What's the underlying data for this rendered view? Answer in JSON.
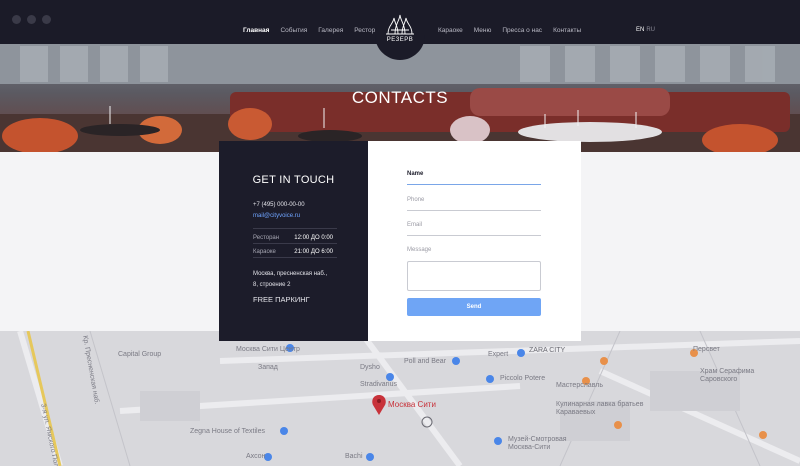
{
  "nav": {
    "left": [
      "Главная",
      "События",
      "Галерея",
      "Ресторан"
    ],
    "right": [
      "Караоке",
      "Меню",
      "Пресса о нас",
      "Контакты"
    ],
    "active": "Главная"
  },
  "logo": {
    "text": "РЕЗЕРВ"
  },
  "lang": {
    "current": "EN",
    "other": "RU"
  },
  "hero": {
    "title": "CONTACTS"
  },
  "info": {
    "title": "GET IN TOUCH",
    "phone": "+7 (495) 000-00-00",
    "email": "mail@cityvoice.ru",
    "hours": [
      {
        "label": "Ресторан",
        "value": "12:00 ДО 0:00"
      },
      {
        "label": "Караоке",
        "value": "21:00 ДО 6:00"
      }
    ],
    "address_line1": "Москва, пресненская наб.,",
    "address_line2": "8, строение 2",
    "parking": "FREE ПАРКИНГ"
  },
  "form": {
    "name_label": "Name",
    "phone_label": "Phone",
    "email_label": "Email",
    "message_label": "Message",
    "message_value": "",
    "send_label": "Send"
  },
  "map": {
    "labels": [
      "Москва Сити Центр",
      "Capital Group",
      "Запад",
      "Dysho",
      "Stradivarius",
      "Poll and Bear",
      "Expert",
      "ZARA CITY",
      "Piccolo Potere",
      "Мастерславль",
      "Москва Сити",
      "Кулинарная лавка братьев Караваевых",
      "Персвет",
      "Храм Серафима Саровского",
      "Музей-Смотровая Москва-Сити",
      "Zegna House of Textiles",
      "Ахсон",
      "Bachi",
      "Кр. Пресненская наб.",
      "3-я ул. Ямского Поля"
    ]
  },
  "colors": {
    "header_bg": "#1b1b28",
    "panel_dark": "#1c1c2a",
    "accent_blue": "#6fa5f5",
    "email_blue": "#6fa4ff",
    "map_bg": "#d6d6da",
    "pin_red": "#c8323a"
  }
}
